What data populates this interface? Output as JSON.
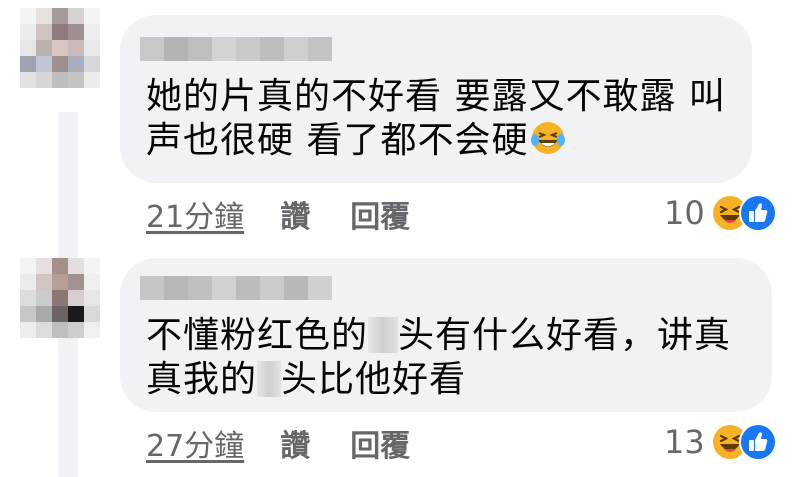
{
  "comments": [
    {
      "text_lines": [
        "她的片真的不好看 要露又不敢露 叫",
        "声也很硬 看了都不会硬"
      ],
      "time": "21分鐘",
      "like_label": "讚",
      "reply_label": "回覆",
      "reaction_count": "10",
      "reaction_icons": [
        "laughing-icon",
        "thumbs-up-icon"
      ]
    },
    {
      "text_line1_before": "不懂粉红色的",
      "text_line1_after": "头有什么好看，讲真",
      "text_line2_before": "真我的",
      "text_line2_after": "头比他好看",
      "time": "27分鐘",
      "like_label": "讚",
      "reply_label": "回覆",
      "reaction_count": "13",
      "reaction_icons": [
        "laughing-icon",
        "thumbs-up-icon"
      ]
    }
  ],
  "colors": {
    "bubble": "#f0f2f5",
    "text": "#050505",
    "meta": "#65676b",
    "like_blue": "#1877f2",
    "haha_yellow": "#f7b125"
  }
}
